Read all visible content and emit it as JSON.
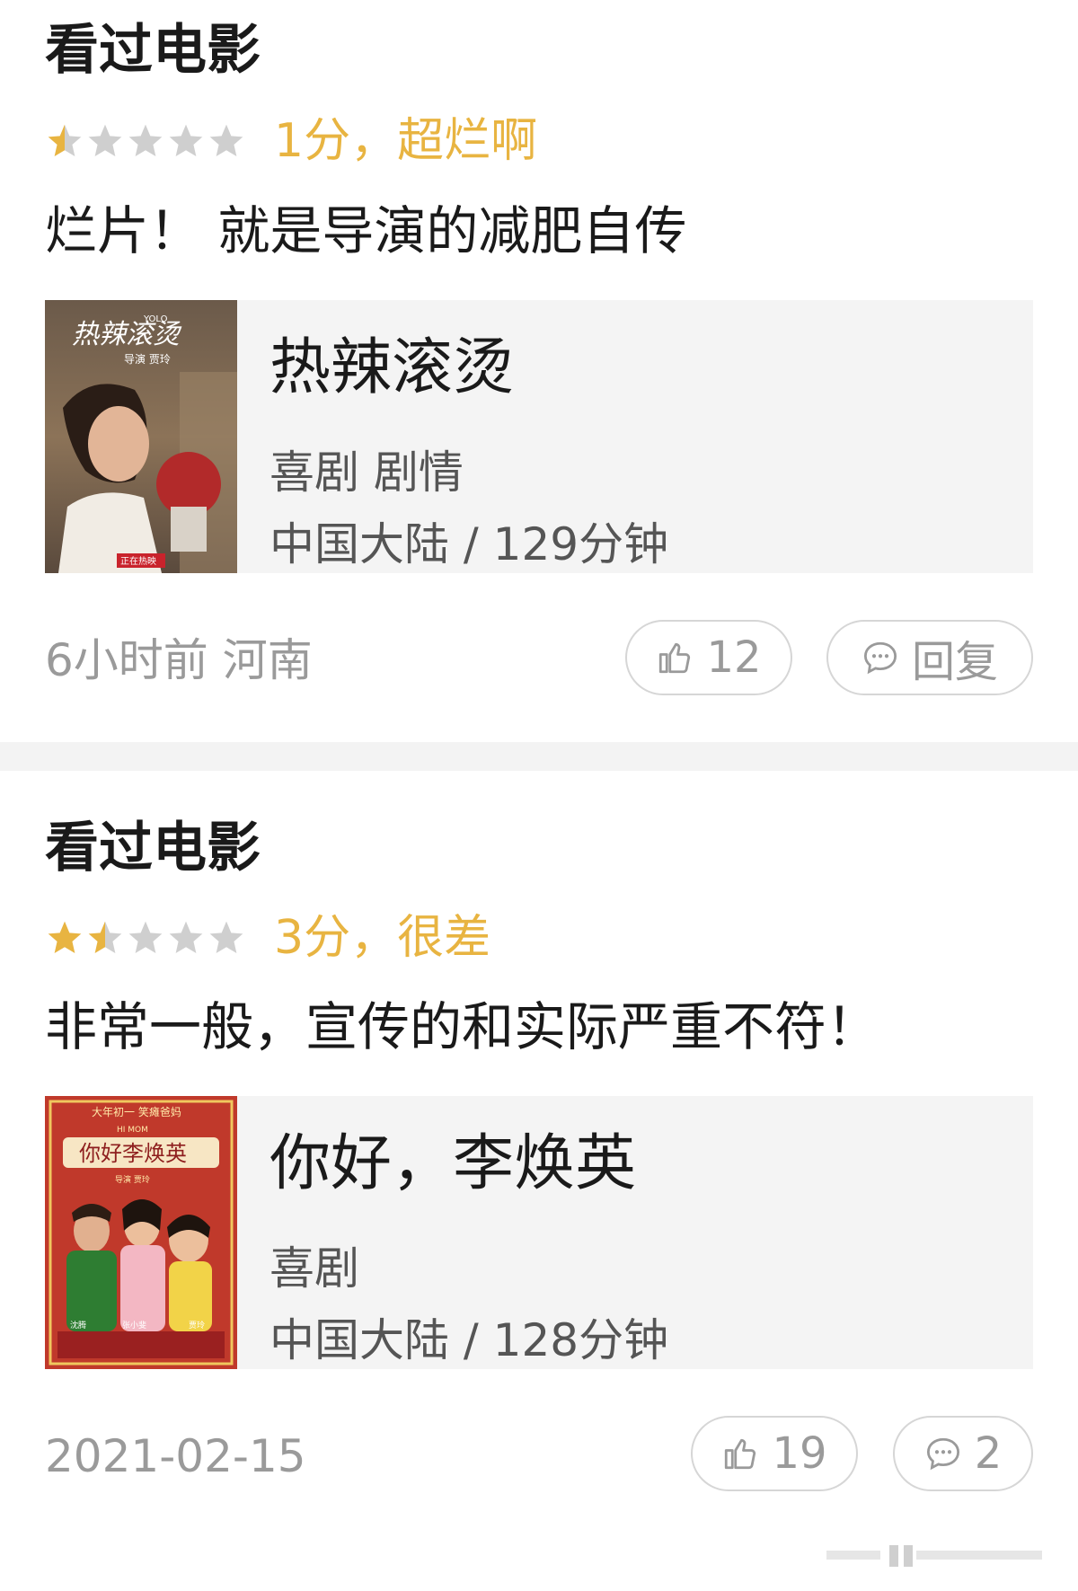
{
  "reviews": [
    {
      "heading": "看过电影",
      "rating_text": "1分，超烂啊",
      "stars": 0.5,
      "comment": "烂片！ 就是导演的减肥自传",
      "movie": {
        "title": "热辣滚烫",
        "genre": "喜剧 剧情",
        "meta": "中国大陆 / 129分钟",
        "poster_text": {
          "title": "热辣滚烫",
          "yolo": "YOLO",
          "director": "导演 贾玲",
          "badge": "正在热映"
        }
      },
      "time_location": "6小时前 河南",
      "likes": "12",
      "reply_label": "回复",
      "accent": "#e8b441"
    },
    {
      "heading": "看过电影",
      "rating_text": "3分，很差",
      "stars": 1.5,
      "comment": "非常一般，宣传的和实际严重不符！",
      "movie": {
        "title": "你好，李焕英",
        "genre": "喜剧",
        "meta": "中国大陆 / 128分钟",
        "poster_text": {
          "tagline": "大年初一 笑瘫爸妈",
          "hi_mom": "HI MOM",
          "title": "你好李焕英",
          "director": "导演 贾玲",
          "cast_1": "沈腾",
          "cast_2": "张小斐",
          "cast_3": "贾玲"
        }
      },
      "time_location": "2021-02-15",
      "likes": "19",
      "reply_label": "2",
      "accent": "#e8b441"
    }
  ],
  "icons": [
    "star-icon",
    "thumbs-up-icon",
    "comment-icon"
  ]
}
